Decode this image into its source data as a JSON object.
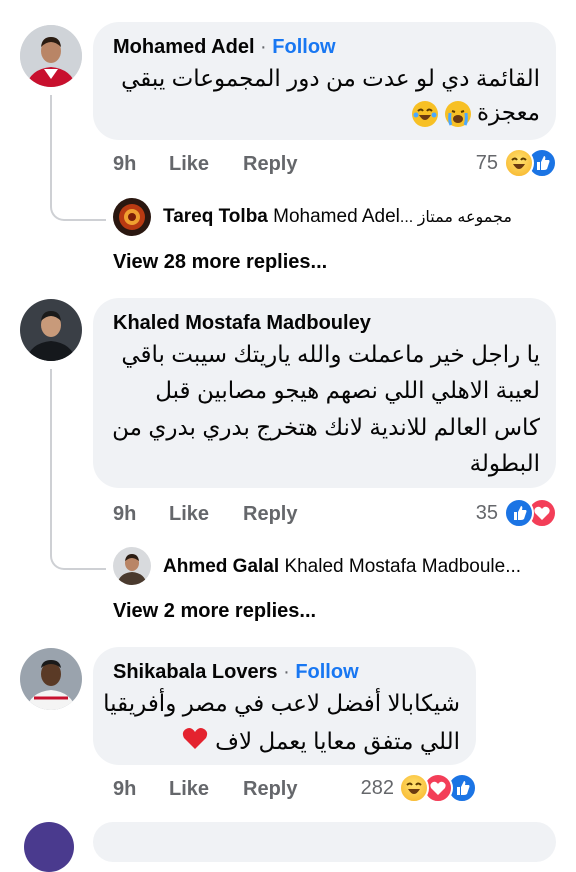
{
  "comments": [
    {
      "author": "Mohamed Adel",
      "follow": "Follow",
      "text_lines": [
        "القائمة دي لو عدت من دور المجموعات يبقي",
        "معجزة"
      ],
      "time": "9h",
      "like": "Like",
      "reply": "Reply",
      "reaction_count": "75",
      "reactions": [
        "haha",
        "like"
      ],
      "reply_preview": {
        "author": "Tareq Tolba",
        "text": "Mohamed Adel",
        "tail": "... مجموعه ممتاز"
      },
      "more_replies": "View 28 more replies..."
    },
    {
      "author": "Khaled Mostafa Madbouley",
      "text_lines": [
        "يا راجل خير ماعملت والله ياريتك سيبت باقي",
        "لعيبة الاهلي اللي نصهم هيجو مصابين قبل",
        "كاس العالم للاندية لانك هتخرج بدري بدري من",
        "البطولة"
      ],
      "time": "9h",
      "like": "Like",
      "reply": "Reply",
      "reaction_count": "35",
      "reactions": [
        "like",
        "love"
      ],
      "reply_preview": {
        "author": "Ahmed Galal",
        "text": "Khaled Mostafa Madboule..."
      },
      "more_replies": "View 2 more replies..."
    },
    {
      "author": "Shikabala Lovers",
      "follow": "Follow",
      "text_lines": [
        "شيكابالا أفضل لاعب في مصر وأفريقيا",
        "اللي متفق معايا يعمل لاف"
      ],
      "time": "9h",
      "like": "Like",
      "reply": "Reply",
      "reaction_count": "282",
      "reactions": [
        "haha",
        "love",
        "like"
      ]
    }
  ],
  "colors": {
    "accent": "#1877f2",
    "bubble": "#f0f2f5",
    "muted": "#65676b",
    "like": "#1b74e4",
    "love": "#f33e58",
    "haha": "#f7b125"
  }
}
